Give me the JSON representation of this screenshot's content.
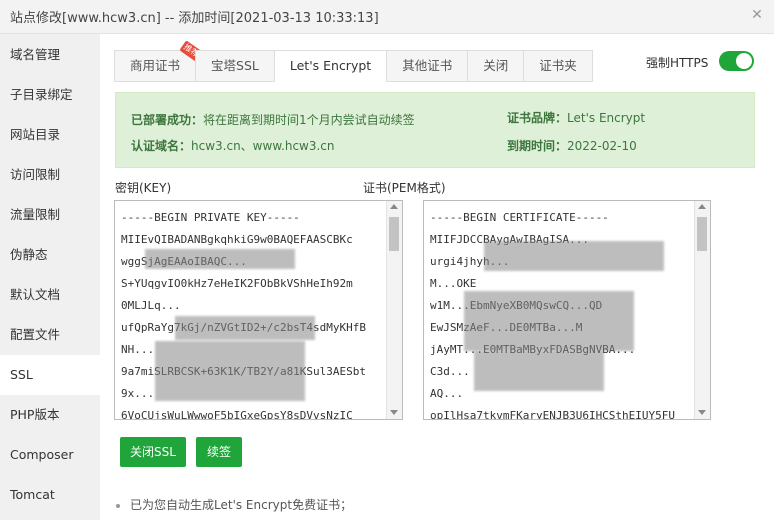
{
  "window": {
    "title": "站点修改[www.hcw3.cn] -- 添加时间[2021-03-13 10:33:13]",
    "close_icon": "close-icon"
  },
  "sidebar": {
    "items": [
      {
        "label": "域名管理"
      },
      {
        "label": "子目录绑定"
      },
      {
        "label": "网站目录"
      },
      {
        "label": "访问限制"
      },
      {
        "label": "流量限制"
      },
      {
        "label": "伪静态"
      },
      {
        "label": "默认文档"
      },
      {
        "label": "配置文件"
      },
      {
        "label": "SSL"
      },
      {
        "label": "PHP版本"
      },
      {
        "label": "Composer"
      },
      {
        "label": "Tomcat"
      }
    ],
    "active": "SSL"
  },
  "tabs": [
    {
      "label": "商用证书",
      "badge": "推荐"
    },
    {
      "label": "宝塔SSL"
    },
    {
      "label": "Let's Encrypt"
    },
    {
      "label": "其他证书"
    },
    {
      "label": "关闭"
    },
    {
      "label": "证书夹"
    }
  ],
  "active_tab": "Let's Encrypt",
  "force_https": {
    "label": "强制HTTPS",
    "enabled": true,
    "color": "#20a53a"
  },
  "info": {
    "deploy_key": "已部署成功：",
    "deploy_value": "将在距离到期时间1个月内尝试自动续签",
    "domain_key": "认证域名：",
    "domain_value": "hcw3.cn、www.hcw3.cn",
    "brand_key": "证书品牌：",
    "brand_value": "Let's Encrypt",
    "expire_key": "到期时间：",
    "expire_value": "2022-02-10"
  },
  "key_box": {
    "label": "密钥(KEY)",
    "lines": [
      "-----BEGIN PRIVATE KEY-----",
      "MIIEvQIBADANBgkqhkiG9w0BAQEFAASCBKc",
      "wggSjAgEAAoIBAQC...",
      "S+YUqgvIO0kHz7eHeIK2FObBkVShHeIh92m",
      "0MLJLq...",
      "ufQpRaYg7kGj/nZVGtID2+/c2bsT4sdMyKHfB",
      "NH...",
      "9a7miSLRBCSK+63K1K/TB2Y/a81KSul3AESbt",
      "9x...",
      "6VoCUjsWuLWwwoF5bIGxeGpsY8sDVvsNzIC"
    ]
  },
  "cert_box": {
    "label": "证书(PEM格式)",
    "lines": [
      "-----BEGIN CERTIFICATE-----",
      "MIIFJDCCBAygAwIBAgISA...",
      "urgi4jhyh...",
      "M...OKE",
      "w1M...EbmNyeXB0MQswCQ...QD",
      "EwJSMzAeF...DE0MTBa...M",
      "jAyMT...E0MTBaMByxFDASBgNVBA...",
      "C3d...",
      "AQ...",
      "opIlHsa7tkvmFKaryENJB3U6IHCSthEIUY5FU"
    ]
  },
  "buttons": {
    "close_ssl": "关闭SSL",
    "renew": "续签"
  },
  "note": "已为您自动生成Let's Encrypt免费证书；"
}
